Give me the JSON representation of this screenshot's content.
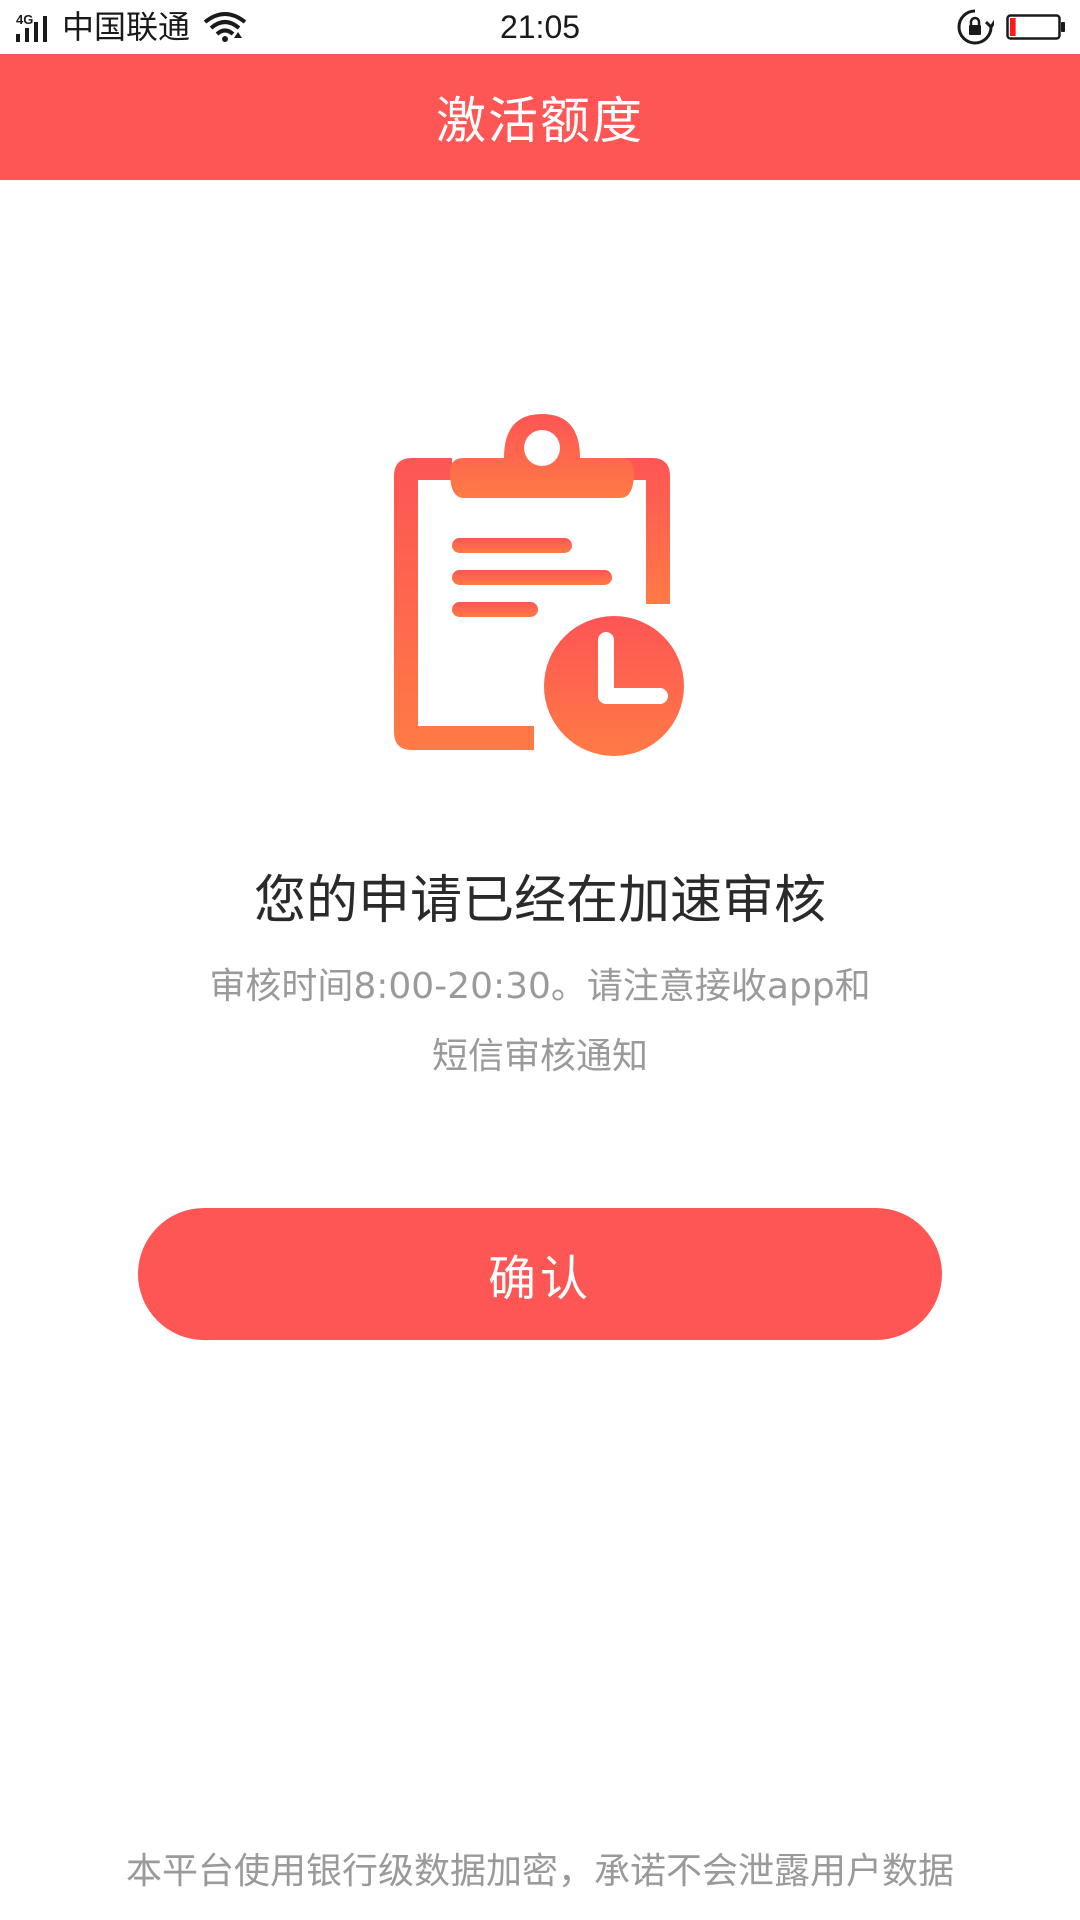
{
  "status_bar": {
    "network_type": "4G",
    "carrier": "中国联通",
    "time": "21:05",
    "battery_level": 0.12
  },
  "header": {
    "title": "激活额度"
  },
  "main": {
    "illustration_icon": "clipboard-clock-icon",
    "headline": "您的申请已经在加速审核",
    "subtext": "审核时间8:00-20:30。请注意接收app和短信审核通知",
    "confirm_label": "确认"
  },
  "footer": {
    "note": "本平台使用银行级数据加密，承诺不会泄露用户数据"
  },
  "colors": {
    "accent": "#fe5555",
    "illustration_top": "#fe5555",
    "illustration_bottom": "#ff7a45",
    "subtext": "#9a9a9a",
    "headline": "#2a2a2a"
  }
}
